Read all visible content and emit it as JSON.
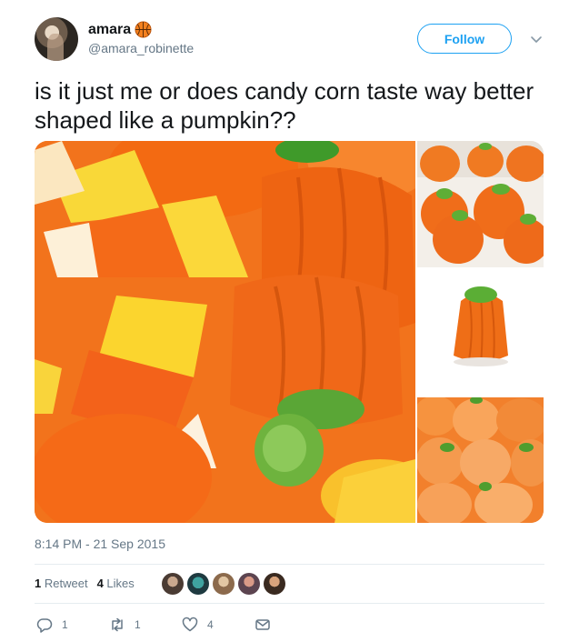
{
  "user": {
    "display_name": "amara",
    "handle": "@amara_robinette",
    "name_emoji": "basketball-icon"
  },
  "follow": {
    "label": "Follow"
  },
  "tweet": {
    "text": "is it just me or does candy corn taste way better shaped like a pumpkin??",
    "timestamp": "8:14 PM - 21 Sep 2015"
  },
  "stats": {
    "retweets_count": "1",
    "retweets_label": "Retweet",
    "likes_count": "4",
    "likes_label": "Likes"
  },
  "actions": {
    "reply_count": "1",
    "retweet_count": "1",
    "like_count": "4"
  },
  "colors": {
    "accent": "#1da1f2",
    "text": "#14171a",
    "muted": "#657786",
    "divider": "#e6ecf0"
  }
}
